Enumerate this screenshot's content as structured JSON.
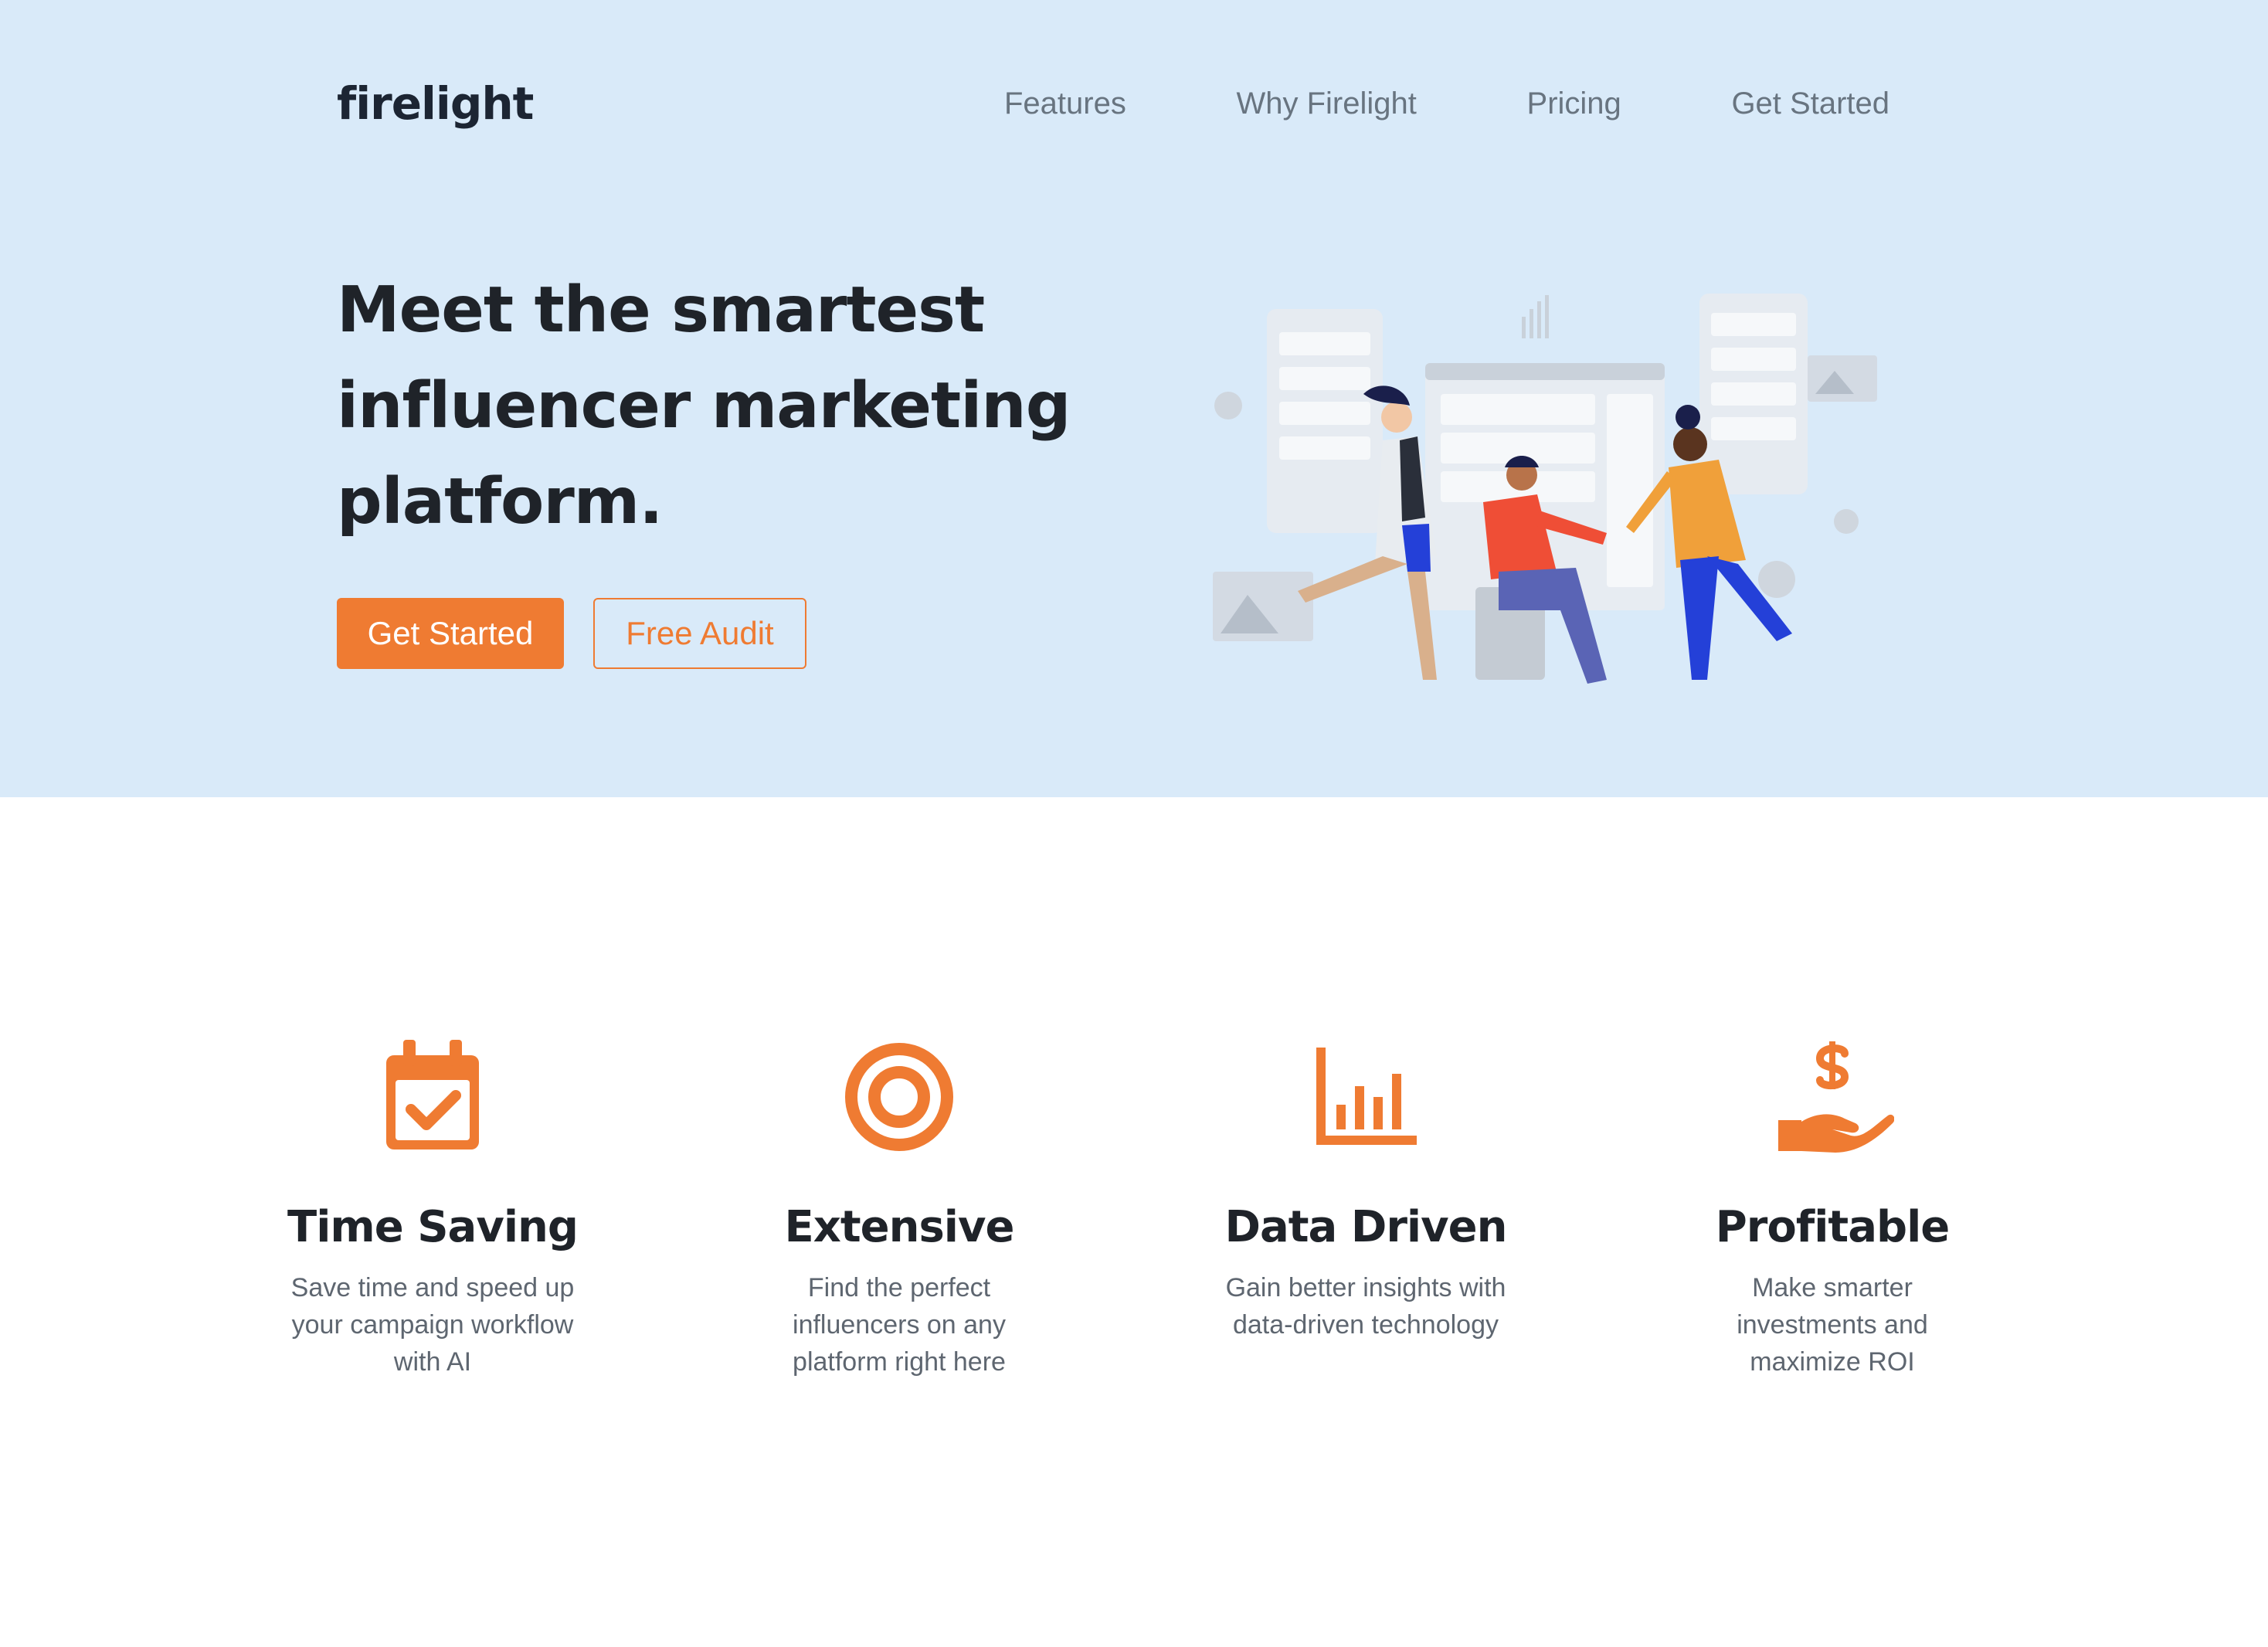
{
  "brand": {
    "name": "firelight",
    "accent": "#ef7b32",
    "hero_bg": "#d9eaf9"
  },
  "nav": {
    "items": [
      {
        "label": "Features"
      },
      {
        "label": "Why Firelight"
      },
      {
        "label": "Pricing"
      },
      {
        "label": "Get Started"
      }
    ]
  },
  "hero": {
    "headline": "Meet the smartest influencer marketing platform.",
    "primary_button": "Get Started",
    "secondary_button": "Free Audit",
    "illustration": "team-collaboration-illustration"
  },
  "features": [
    {
      "icon": "calendar-check-icon",
      "title": "Time Saving",
      "description": "Save time and speed up your campaign workflow with AI"
    },
    {
      "icon": "target-icon",
      "title": "Extensive",
      "description": "Find the perfect influencers on any platform right here"
    },
    {
      "icon": "bar-chart-icon",
      "title": "Data Driven",
      "description": "Gain better insights with data-driven technology"
    },
    {
      "icon": "hand-dollar-icon",
      "title": "Profitable",
      "description": "Make smarter investments and maximize ROI"
    }
  ]
}
